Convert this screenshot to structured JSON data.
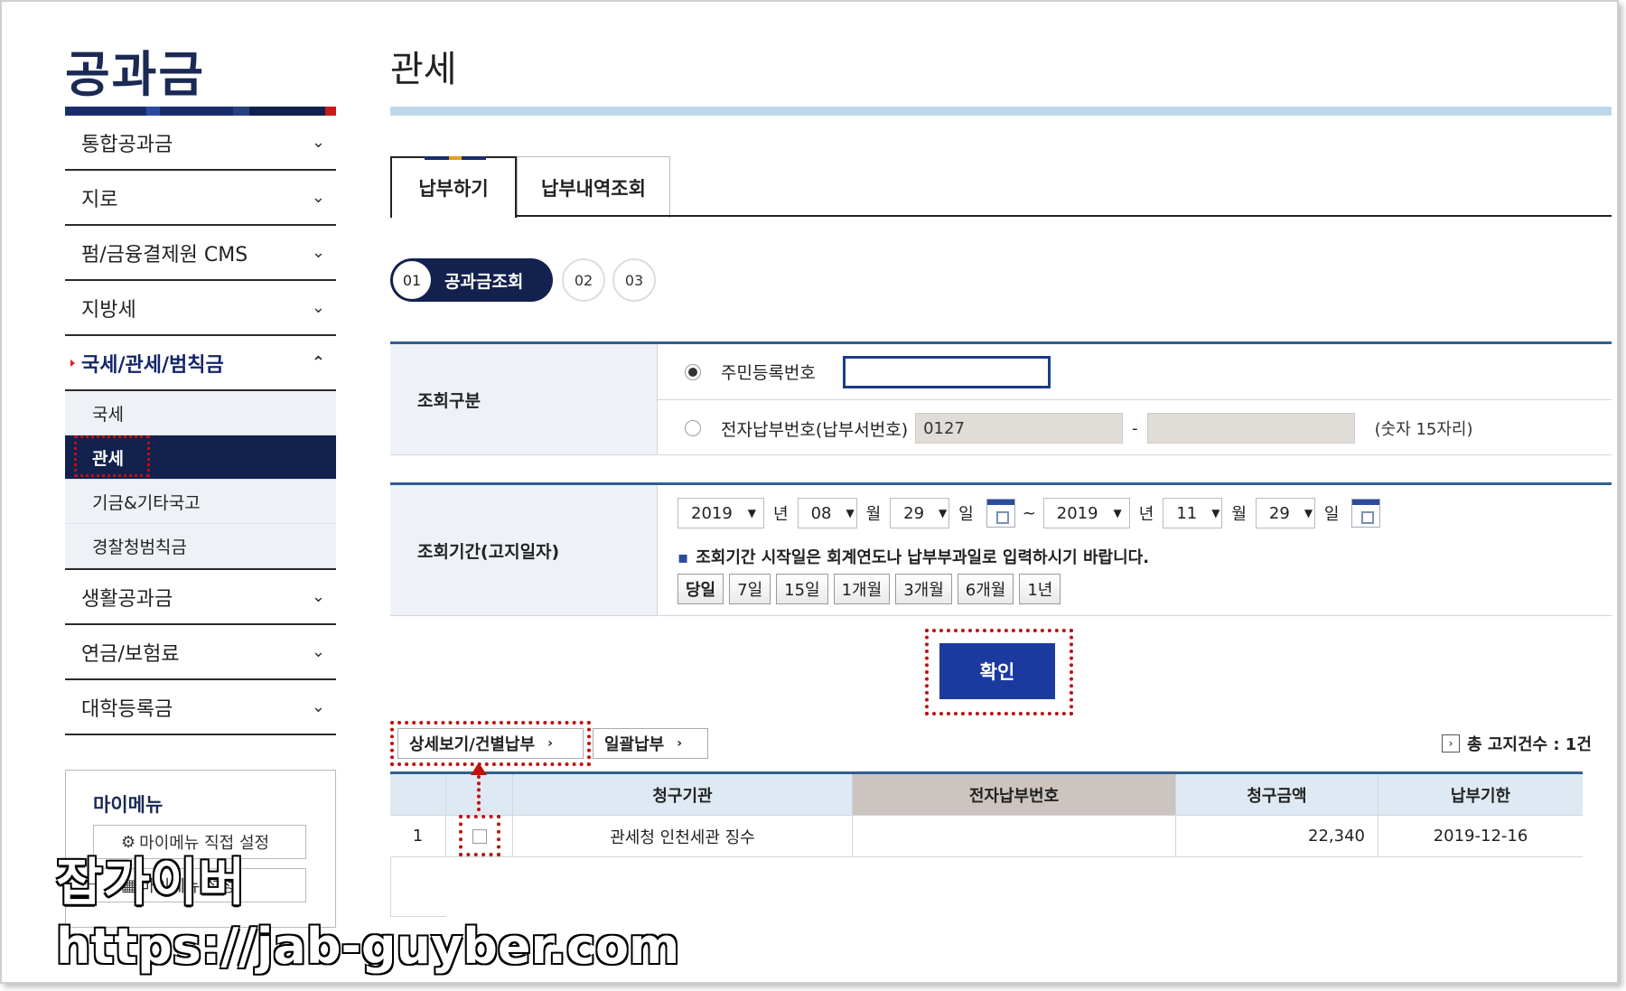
{
  "sidebar": {
    "title": "공과금",
    "items": [
      {
        "label": "통합공과금"
      },
      {
        "label": "지로"
      },
      {
        "label": "펌/금융결제원 CMS"
      },
      {
        "label": "지방세"
      },
      {
        "label": "국세/관세/범칙금"
      },
      {
        "label": "생활공과금"
      },
      {
        "label": "연금/보험료"
      },
      {
        "label": "대학등록금"
      }
    ],
    "sub_items": [
      {
        "label": "국세"
      },
      {
        "label": "관세"
      },
      {
        "label": "기금&기타국고"
      },
      {
        "label": "경찰청범칙금"
      }
    ],
    "mymenu": {
      "title": "마이메뉴",
      "setup_label": "마이메뉴 직접 설정",
      "second_label": "마이메뉴 설정"
    }
  },
  "watermark": {
    "name": "잡가이버",
    "url": "https://jab-guyber.com"
  },
  "main": {
    "title": "관세",
    "tabs": [
      {
        "label": "납부하기"
      },
      {
        "label": "납부내역조회"
      }
    ],
    "steps": [
      {
        "num": "01",
        "label": "공과금조회"
      },
      {
        "num": "02"
      },
      {
        "num": "03"
      }
    ],
    "search_type": {
      "label": "조회구분",
      "option1": "주민등록번호",
      "option2": "전자납부번호(납부서번호)",
      "prefix_value": "0127",
      "separator": "-",
      "hint": "(숫자 15자리)"
    },
    "period": {
      "label": "조회기간(고지일자)",
      "from": {
        "year": "2019",
        "month": "08",
        "day": "29"
      },
      "to": {
        "year": "2019",
        "month": "11",
        "day": "29"
      },
      "unit_year": "년",
      "unit_month": "월",
      "unit_day": "일",
      "tilde": "~",
      "note_bullet": "▪",
      "note": "조회기간 시작일은 회계연도나 납부부과일로 입력하시기 바랍니다.",
      "buttons": [
        "당일",
        "7일",
        "15일",
        "1개월",
        "3개월",
        "6개월",
        "1년"
      ]
    },
    "confirm_label": "확인",
    "actions": {
      "detail_label": "상세보기/건별납부",
      "bulk_label": "일괄납부",
      "total_label": "총 고지건수 : 1건"
    },
    "table": {
      "headers": [
        "",
        "",
        "청구기관",
        "전자납부번호",
        "청구금액",
        "납부기한"
      ],
      "rows": [
        {
          "no": "1",
          "agency": "관세청 인천세관 징수",
          "number": "",
          "amount": "22,340",
          "due": "2019-12-16"
        }
      ]
    }
  },
  "colors": {
    "navy": "#13214e",
    "accent_blue": "#1a3aa0",
    "highlight_red": "#c01010"
  }
}
